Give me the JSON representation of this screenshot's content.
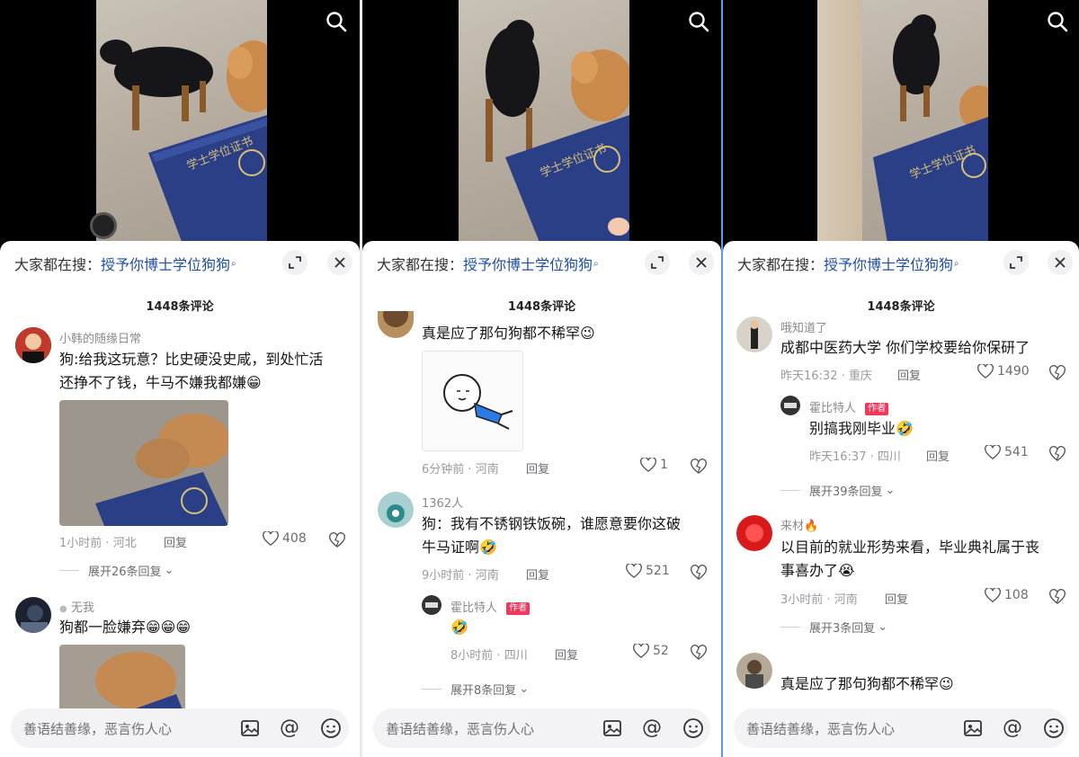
{
  "panels": [
    {
      "search_label": "大家都在搜：",
      "search_keyword": "授予你博士学位狗狗",
      "comment_count": "1448条评论",
      "comments": [
        {
          "user": "小韩的随缘日常",
          "text_line1": "狗:给我这玩意？比史硬没史咸，到处忙活",
          "text_line2": "还挣不了钱，牛马不嫌我都嫌😁",
          "time": "1小时前",
          "location": "河北",
          "reply": "回复",
          "likes": "408",
          "expand": "展开26条回复"
        },
        {
          "user": "无我",
          "text_line1": "狗都一脸嫌弃😁😁😁"
        }
      ],
      "input_placeholder": "善语结善缘，恶言伤人心"
    },
    {
      "search_label": "大家都在搜：",
      "search_keyword": "授予你博士学位狗狗",
      "comment_count": "1448条评论",
      "comments": [
        {
          "text_line1": "真是应了那句狗都不稀罕😉",
          "time": "6分钟前",
          "location": "河南",
          "reply": "回复",
          "likes": "1"
        },
        {
          "user": "1362人",
          "text_line1": "狗：我有不锈钢铁饭碗，谁愿意要你这破",
          "text_line2": "牛马证啊🤣",
          "time": "9小时前",
          "location": "河南",
          "reply": "回复",
          "likes": "521"
        },
        {
          "user": "霍比特人",
          "badge": "作者",
          "text_line1": "🤣",
          "time": "8小时前",
          "location": "四川",
          "reply": "回复",
          "likes": "52",
          "expand": "展开8条回复"
        }
      ],
      "input_placeholder": "善语结善缘，恶言伤人心"
    },
    {
      "search_label": "大家都在搜：",
      "search_keyword": "授予你博士学位狗狗",
      "comment_count": "1448条评论",
      "comments": [
        {
          "user": "哦知道了",
          "text_line1": "成都中医药大学 你们学校要给你保研了",
          "time": "昨天16:32",
          "location": "重庆",
          "reply": "回复",
          "likes": "1490"
        },
        {
          "user": "霍比特人",
          "badge": "作者",
          "text_line1": "别搞我刚毕业🤣",
          "time": "昨天16:37",
          "location": "四川",
          "reply": "回复",
          "likes": "541",
          "expand": "展开39条回复"
        },
        {
          "user": "来材🔥",
          "text_line1": "以目前的就业形势来看，毕业典礼属于丧",
          "text_line2": "事喜办了😭",
          "time": "3小时前",
          "location": "河南",
          "reply": "回复",
          "likes": "108",
          "expand": "展开3条回复"
        },
        {
          "text_line1": "真是应了那句狗都不稀罕😉"
        }
      ],
      "input_placeholder": "善语结善缘，恶言伤人心"
    }
  ],
  "certificate_text": "学士学位证书",
  "colors": {
    "keyword": "#1e4fa8",
    "badge": "#f2385a",
    "certificate": "#2b3f86"
  }
}
